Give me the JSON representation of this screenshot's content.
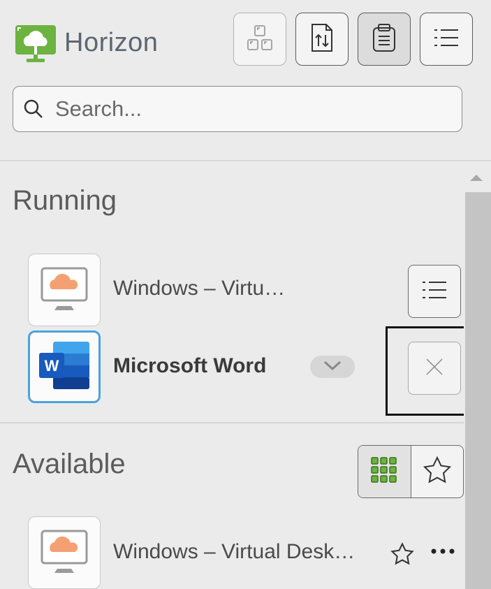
{
  "app": {
    "logo_text": "Horizon"
  },
  "toolbar": {
    "buttons": [
      {
        "icon": "apps-layout-icon",
        "state": "disabled"
      },
      {
        "icon": "transfer-icon",
        "state": "normal"
      },
      {
        "icon": "clipboard-icon",
        "state": "active"
      },
      {
        "icon": "list-icon",
        "state": "normal"
      }
    ]
  },
  "search": {
    "placeholder": "Search...",
    "value": ""
  },
  "running": {
    "title": "Running",
    "items": [
      {
        "name": "Windows – Virtu…",
        "icon": "virtual-desktop-icon",
        "action": "menu"
      },
      {
        "name": "Microsoft Word",
        "icon": "word-icon",
        "action": "close",
        "selected": true
      }
    ]
  },
  "available": {
    "title": "Available",
    "view_toggle": [
      "grid-view",
      "favorites"
    ],
    "items": [
      {
        "name": "Windows – Virtual Desk…",
        "icon": "virtual-desktop-icon"
      }
    ]
  },
  "colors": {
    "brand_green": "#6cb33f",
    "accent_blue": "#4aa3dc",
    "cloud_orange": "#f4a072",
    "word_blue": "#185abd"
  }
}
